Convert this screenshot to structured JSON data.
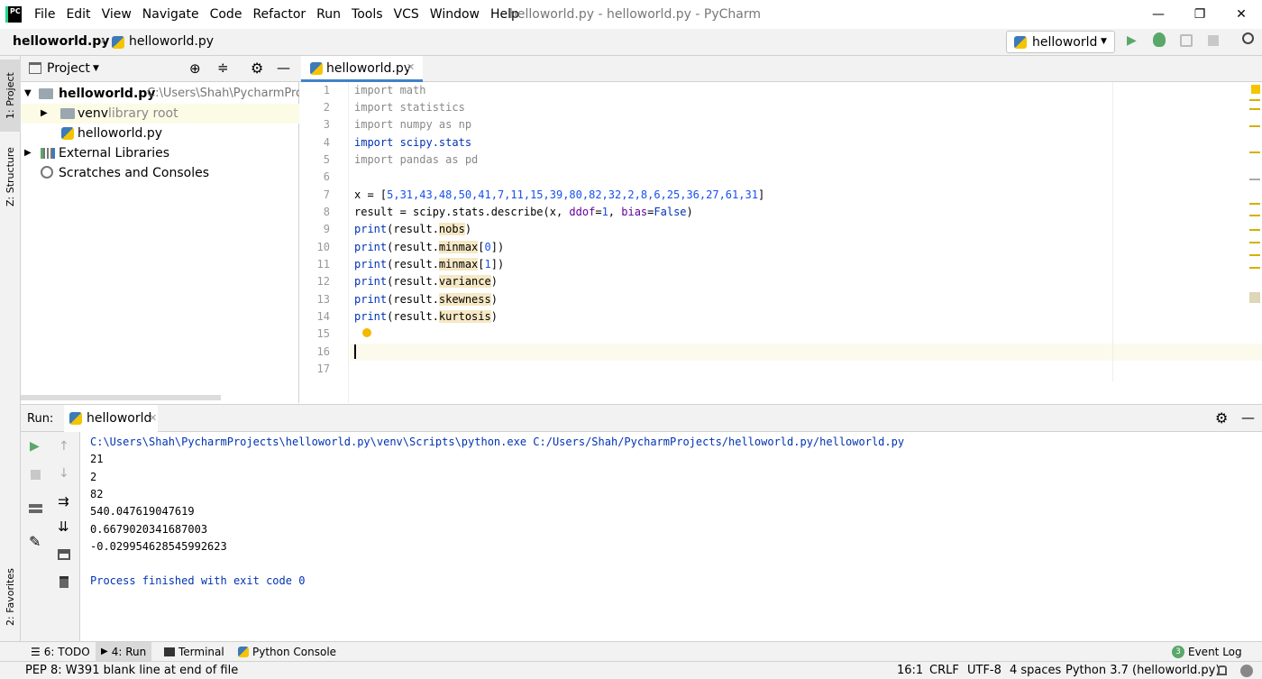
{
  "app": {
    "logo": "PC",
    "title": "helloworld.py - helloworld.py - PyCharm"
  },
  "menu": [
    "File",
    "Edit",
    "View",
    "Navigate",
    "Code",
    "Refactor",
    "Run",
    "Tools",
    "VCS",
    "Window",
    "Help"
  ],
  "window_controls": {
    "minimize": "—",
    "restore": "❐",
    "close": "✕"
  },
  "breadcrumb": {
    "project": "helloworld.py",
    "file": "helloworld.py"
  },
  "run_config": {
    "name": "helloworld"
  },
  "left_tabs": {
    "project": "1: Project",
    "structure": "Z: Structure",
    "favorites": "2: Favorites"
  },
  "project_panel": {
    "title": "Project",
    "tree": [
      {
        "label": "helloworld.py",
        "extra": "C:\\Users\\Shah\\PycharmProj"
      },
      {
        "label": "venv",
        "extra": "library root"
      },
      {
        "label": "helloworld.py",
        "extra": ""
      },
      {
        "label": "External Libraries",
        "extra": ""
      },
      {
        "label": "Scratches and Consoles",
        "extra": ""
      }
    ]
  },
  "editor": {
    "tab_label": "helloworld.py",
    "line_numbers": [
      "1",
      "2",
      "3",
      "4",
      "5",
      "6",
      "7",
      "8",
      "9",
      "10",
      "11",
      "12",
      "13",
      "14",
      "15",
      "16",
      "17"
    ],
    "code": {
      "l1": "import math",
      "l2": "import statistics",
      "l3": "import numpy as np",
      "l4": "import scipy.stats",
      "l5": "import pandas as pd",
      "l7a": "x = [",
      "l7b": "5,31,43,48,50,41,7,11,15,39,80,82,32,2,8,6,25,36,27,61,31",
      "l7c": "]",
      "l8a": "result = scipy.stats.describe(x, ",
      "l8b": "ddof",
      "l8c": "=",
      "l8d": "1",
      "l8e": ", ",
      "l8f": "bias",
      "l8g": "=",
      "l8h": "False",
      "l8i": ")",
      "print": "print",
      "res": "(result.",
      "l9": "nobs",
      "l10a": "minmax",
      "l10b": "0",
      "l11b": "1",
      "l12": "variance",
      "l13": "skewness",
      "l14": "kurtosis",
      "close": ")",
      "br_open": "[",
      "br_close": "])"
    }
  },
  "run_panel": {
    "label": "Run:",
    "tab": "helloworld",
    "output": [
      "C:\\Users\\Shah\\PycharmProjects\\helloworld.py\\venv\\Scripts\\python.exe C:/Users/Shah/PycharmProjects/helloworld.py/helloworld.py",
      "21",
      "2",
      "82",
      "540.047619047619",
      "0.6679020341687003",
      "-0.029954628545992623",
      "",
      "Process finished with exit code 0"
    ]
  },
  "bottom_tabs": {
    "todo": "6: TODO",
    "run": "4: Run",
    "terminal": "Terminal",
    "console": "Python Console",
    "event_log": "Event Log",
    "event_count": "3"
  },
  "status": {
    "message": "PEP 8: W391 blank line at end of file",
    "position": "16:1",
    "line_sep": "CRLF",
    "encoding": "UTF-8",
    "indent": "4 spaces",
    "interpreter": "Python 3.7 (helloworld.py)"
  }
}
